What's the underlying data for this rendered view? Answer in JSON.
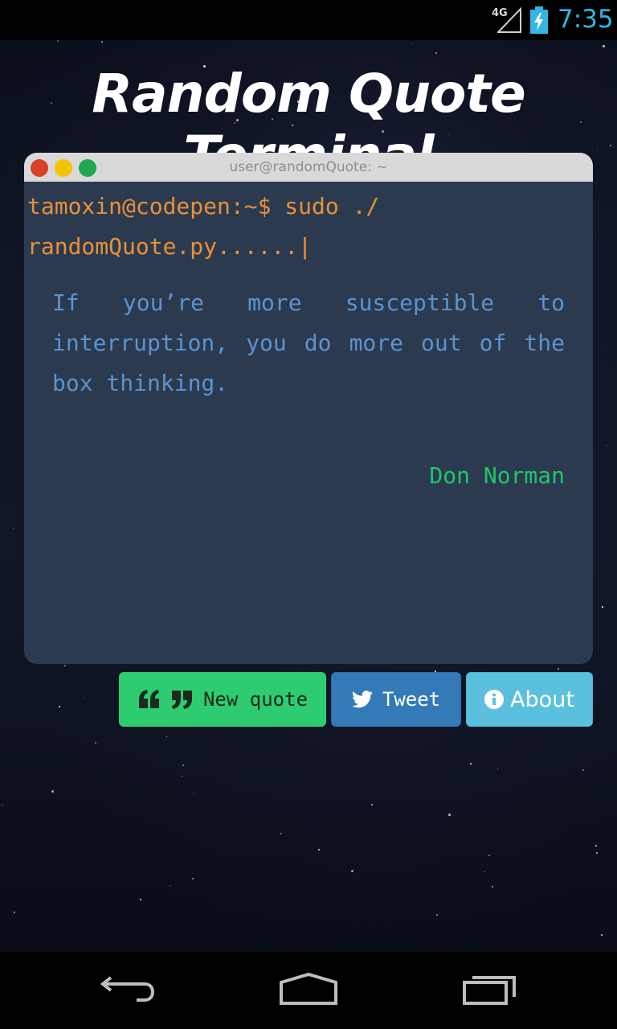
{
  "status_bar": {
    "network": "4G",
    "time": "7:35"
  },
  "app": {
    "title": "Random Quote Terminal"
  },
  "terminal": {
    "window_title": "user@randomQuote: ~",
    "prompt": "tamoxin@codepen:~$ sudo ./ randomQuote.py......|",
    "quote": "If you’re more susceptible to interruption, you do more out of the box thinking.",
    "author": "Don Norman"
  },
  "buttons": {
    "new_quote": "New quote",
    "tweet": "Tweet",
    "about": "About"
  },
  "colors": {
    "prompt": "#e8913a",
    "quote": "#5b93cf",
    "author": "#22c46a",
    "new_quote_bg": "#2ecc71",
    "tweet_bg": "#337ab7",
    "about_bg": "#5bc0de"
  },
  "icons": {
    "new_quote": "quote-icon",
    "tweet": "twitter-icon",
    "about": "info-icon"
  }
}
